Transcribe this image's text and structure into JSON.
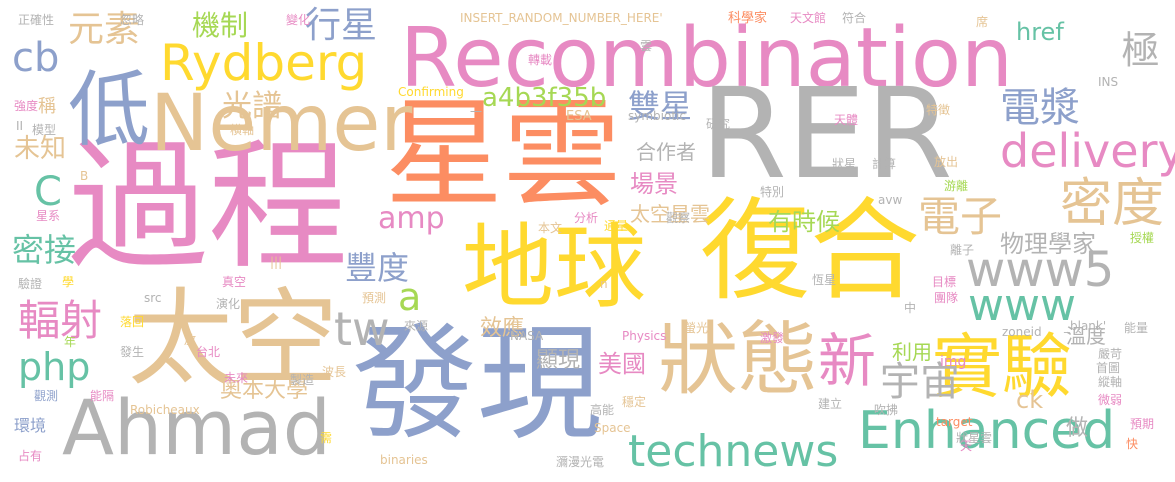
{
  "palette": {
    "pink": "#e78ac3",
    "orange": "#fc8d62",
    "blue": "#8da0cb",
    "green": "#66c2a5",
    "lime": "#a6d854",
    "yellow": "#ffd92f",
    "tan": "#e5c494",
    "gray": "#b3b3b3"
  },
  "words": [
    "Recombination",
    "RER",
    "過程",
    "星雲",
    "地球",
    "復合",
    "發現",
    "太空",
    "Ahmad",
    "Nemer",
    "狀態",
    "實驗",
    "低",
    "technews",
    "Enhanced",
    "Rydberg",
    "新",
    "www5",
    "www",
    "delivery",
    "密度",
    "電漿",
    "電子",
    "宇宙",
    "元素",
    "行星",
    "極",
    "cb",
    "光譜",
    "雙星",
    "amp",
    "php",
    "tw",
    "輻射",
    "豐度",
    "a",
    "C",
    "密接",
    "未知",
    "機制",
    "a4b3f35b",
    "換到",
    "href",
    "物理學家",
    "有時候",
    "太空星雲",
    "場景",
    "合作者",
    "美國",
    "效應",
    "顯現",
    "奧本大學",
    "利用",
    "ck",
    "做",
    "溫度",
    "img",
    "INSERT_RANDOM_NUMBER_HERE'",
    "科學家",
    "天文館",
    "符合",
    "正確性",
    "忽略",
    "變化",
    "稱",
    "強度",
    "模型",
    "橫軸",
    "Confirming",
    "轉載",
    "ESA",
    "symbiotic",
    "研究",
    "特徵",
    "天體",
    "狀星",
    "計算",
    "放出",
    "游離",
    "特別",
    "avw",
    "觀察",
    "分析",
    "本文",
    "通量",
    "授權",
    "離子",
    "恆星",
    "目標",
    "團隊",
    "中",
    "驗證",
    "學",
    "真空",
    "演化",
    "src",
    "預測",
    "來源",
    "NASA",
    "Physics",
    "螢光",
    "激發",
    "zoneid",
    "_blank'",
    "能量",
    "發生",
    "台北",
    "波長",
    "放",
    "落回",
    "未來",
    "製造",
    "觀測",
    "能隔",
    "Robicheaux",
    "環境",
    "高能",
    "穩定",
    "Space",
    "吹拂",
    "建立",
    "嚴苛",
    "首圖",
    "縱軸",
    "微弱",
    "target",
    "狀星雲",
    "預期",
    "快",
    "占有",
    "binaries",
    "瀰漫光電",
    "需",
    "席",
    "INS",
    "星系",
    "年",
    "II",
    "B",
    "|||",
    "n",
    "雲",
    "一",
    "天"
  ]
}
